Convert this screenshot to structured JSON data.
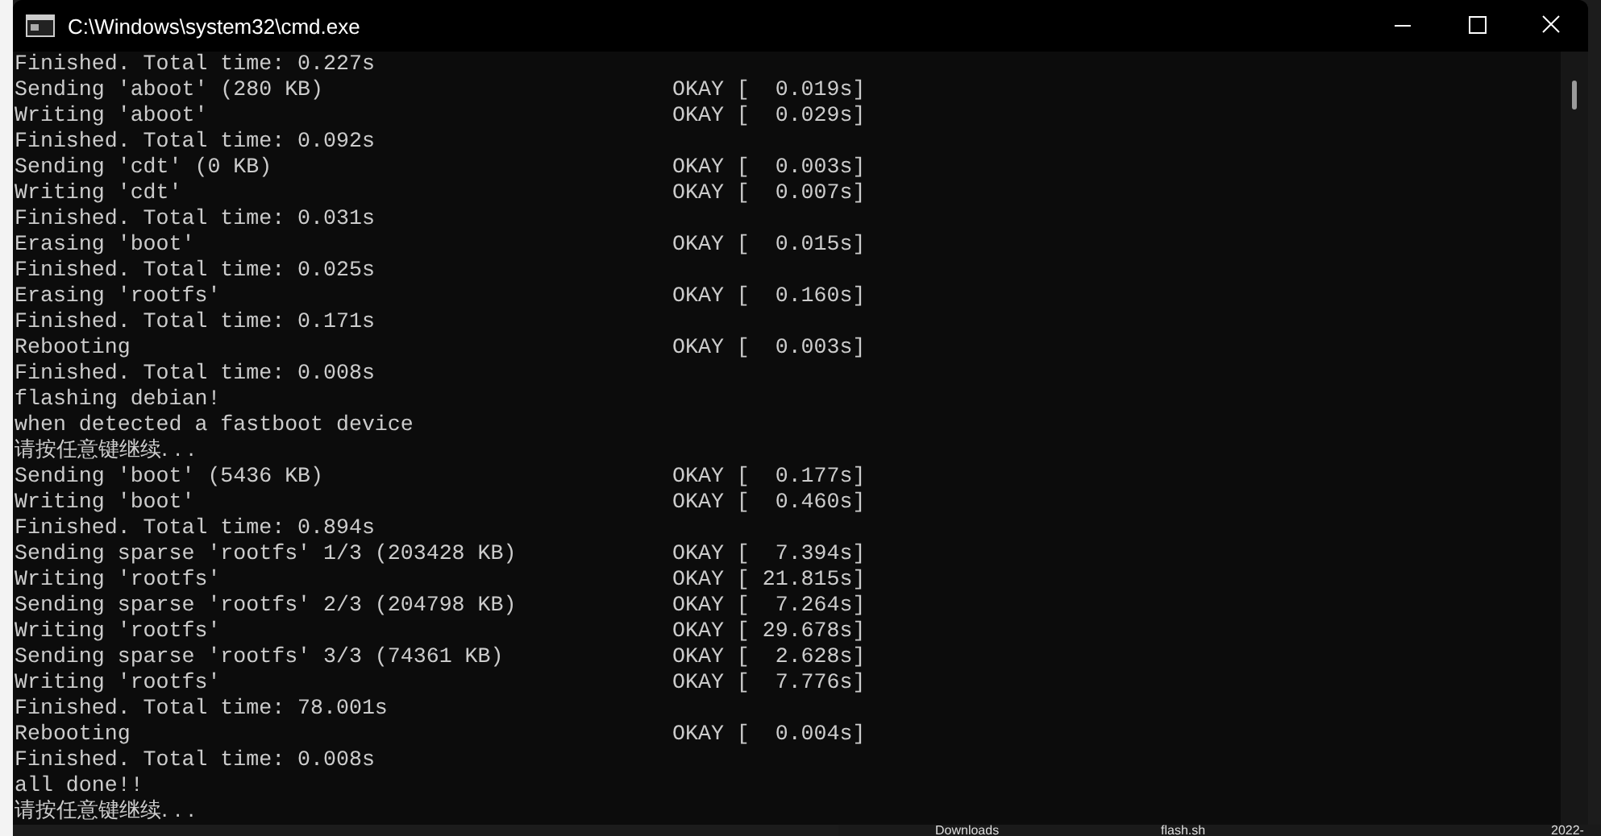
{
  "window": {
    "title": "C:\\Windows\\system32\\cmd.exe"
  },
  "console": {
    "lines": [
      {
        "text": "Finished. Total time: 0.227s"
      },
      {
        "text": "Sending 'aboot' (280 KB)",
        "result": "OKAY [  0.019s]"
      },
      {
        "text": "Writing 'aboot'",
        "result": "OKAY [  0.029s]"
      },
      {
        "text": "Finished. Total time: 0.092s"
      },
      {
        "text": "Sending 'cdt' (0 KB)",
        "result": "OKAY [  0.003s]"
      },
      {
        "text": "Writing 'cdt'",
        "result": "OKAY [  0.007s]"
      },
      {
        "text": "Finished. Total time: 0.031s"
      },
      {
        "text": "Erasing 'boot'",
        "result": "OKAY [  0.015s]"
      },
      {
        "text": "Finished. Total time: 0.025s"
      },
      {
        "text": "Erasing 'rootfs'",
        "result": "OKAY [  0.160s]"
      },
      {
        "text": "Finished. Total time: 0.171s"
      },
      {
        "text": "Rebooting",
        "result": "OKAY [  0.003s]"
      },
      {
        "text": "Finished. Total time: 0.008s"
      },
      {
        "text": "flashing debian!"
      },
      {
        "text": "when detected a fastboot device"
      },
      {
        "text": "请按任意键继续. . ."
      },
      {
        "text": "Sending 'boot' (5436 KB)",
        "result": "OKAY [  0.177s]"
      },
      {
        "text": "Writing 'boot'",
        "result": "OKAY [  0.460s]"
      },
      {
        "text": "Finished. Total time: 0.894s"
      },
      {
        "text": "Sending sparse 'rootfs' 1/3 (203428 KB)",
        "result": "OKAY [  7.394s]"
      },
      {
        "text": "Writing 'rootfs'",
        "result": "OKAY [ 21.815s]"
      },
      {
        "text": "Sending sparse 'rootfs' 2/3 (204798 KB)",
        "result": "OKAY [  7.264s]"
      },
      {
        "text": "Writing 'rootfs'",
        "result": "OKAY [ 29.678s]"
      },
      {
        "text": "Sending sparse 'rootfs' 3/3 (74361 KB)",
        "result": "OKAY [  2.628s]"
      },
      {
        "text": "Writing 'rootfs'",
        "result": "OKAY [  7.776s]"
      },
      {
        "text": "Finished. Total time: 78.001s"
      },
      {
        "text": "Rebooting",
        "result": "OKAY [  0.004s]"
      },
      {
        "text": "Finished. Total time: 0.008s"
      },
      {
        "text": "all done!!"
      },
      {
        "text": "请按任意键继续. . ."
      }
    ]
  },
  "background_explorer": {
    "items": [
      "Downloads",
      "flash.sh",
      "2022-"
    ]
  }
}
